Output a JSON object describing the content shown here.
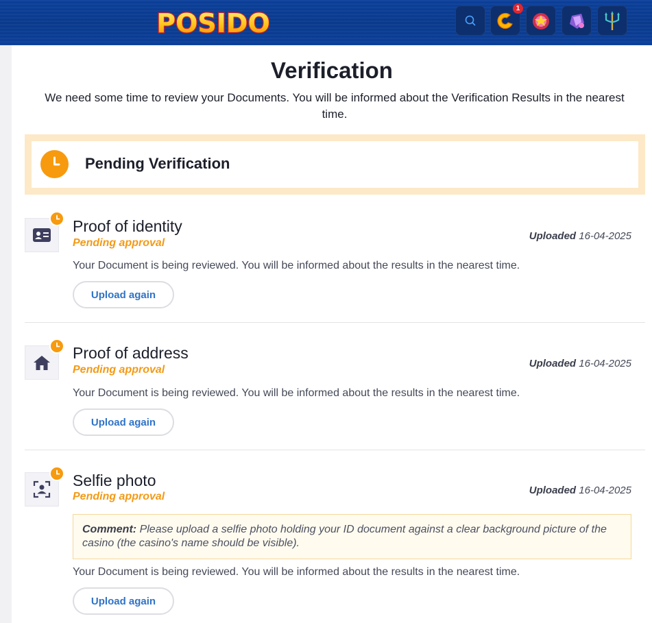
{
  "header": {
    "logo_text": "POSIDO",
    "notification_count": "1",
    "buttons": [
      {
        "icon": "search-icon"
      },
      {
        "icon": "coin-icon"
      },
      {
        "icon": "chest-icon"
      },
      {
        "icon": "crystal-icon"
      },
      {
        "icon": "trident-icon"
      }
    ]
  },
  "page": {
    "title": "Verification",
    "intro": "We need some time to review your Documents. You will be informed about the Verification Results in the nearest time."
  },
  "pending": {
    "title": "Pending Verification"
  },
  "documents": [
    {
      "title": "Proof of identity",
      "status": "Pending approval",
      "uploaded_label": "Uploaded",
      "uploaded_date": "16-04-2025",
      "description": "Your Document is being reviewed. You will be informed about the results in the nearest time.",
      "button": "Upload again",
      "icon": "id-card-icon"
    },
    {
      "title": "Proof of address",
      "status": "Pending approval",
      "uploaded_label": "Uploaded",
      "uploaded_date": "16-04-2025",
      "description": "Your Document is being reviewed. You will be informed about the results in the nearest time.",
      "button": "Upload again",
      "icon": "home-icon"
    },
    {
      "title": "Selfie photo",
      "status": "Pending approval",
      "uploaded_label": "Uploaded",
      "uploaded_date": "16-04-2025",
      "comment_label": "Comment:",
      "comment_text": "Please upload a selfie photo holding your ID document against a clear background picture of the casino (the casino's name should be visible).",
      "description": "Your Document is being reviewed. You will be informed about the results in the nearest time.",
      "button": "Upload again",
      "icon": "selfie-icon"
    }
  ],
  "colors": {
    "header_blue": "#0b3f9a",
    "accent_orange": "#f79a0e",
    "pending_frame": "#fde9c7",
    "link_blue": "#2f73c8"
  }
}
